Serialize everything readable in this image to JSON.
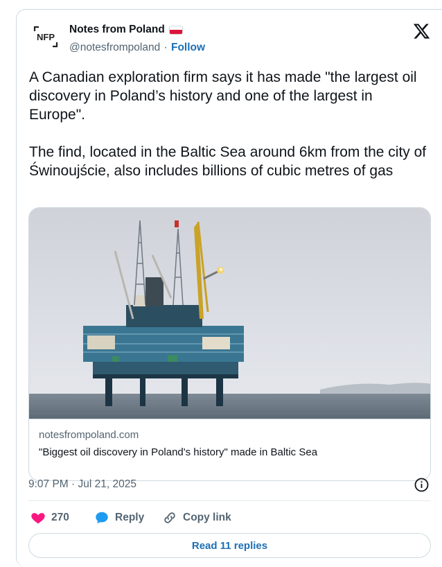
{
  "author": {
    "name": "Notes from Poland",
    "handle": "@notesfrompoland",
    "separator": "·",
    "follow_label": "Follow",
    "avatar_text": "NFP",
    "flag_colors": {
      "top": "#ffffff",
      "bottom": "#dc143c"
    }
  },
  "tweet": {
    "text": "A Canadian exploration firm says it has made \"the largest oil discovery in Poland’s history and one of the largest in Europe\".\n\nThe find, located in the Baltic Sea around 6km from the city of Świnoujście, also includes billions of cubic metres of gas"
  },
  "link_card": {
    "domain": "notesfrompoland.com",
    "title": "\"Biggest oil discovery in Poland's history\" made in Baltic Sea",
    "image": "oil-rig-at-sea-photo"
  },
  "timestamp": "9:07 PM · Jul 21, 2025",
  "actions": {
    "like_count": "270",
    "reply_label": "Reply",
    "copy_label": "Copy link"
  },
  "read_replies_label": "Read 11 replies",
  "colors": {
    "accent": "#1d6fb5",
    "like": "#f91880",
    "muted": "#536471",
    "border": "#cfd9de"
  },
  "icons": {
    "brand": "x-logo-icon",
    "info": "info-icon",
    "like": "heart-icon",
    "reply": "speech-bubble-icon",
    "copy": "link-icon"
  }
}
